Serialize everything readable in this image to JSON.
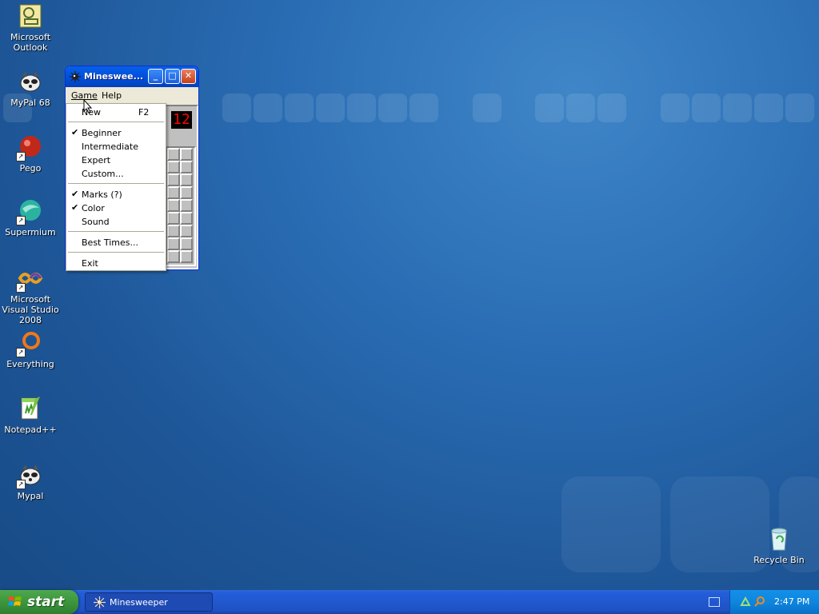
{
  "desktop": {
    "icons": [
      {
        "label": "Microsoft Outlook",
        "icon": "outlook-icon"
      },
      {
        "label": "MyPal 68",
        "icon": "raccoon-icon"
      },
      {
        "label": "Pego",
        "icon": "pego-icon"
      },
      {
        "label": "Supermium",
        "icon": "supermium-icon"
      },
      {
        "label": "Microsoft Visual Studio 2008",
        "icon": "visual-studio-icon"
      },
      {
        "label": "Everything",
        "icon": "everything-icon"
      },
      {
        "label": "Notepad++",
        "icon": "notepadpp-icon"
      },
      {
        "label": "Mypal",
        "icon": "raccoon-icon"
      },
      {
        "label": "Recycle Bin",
        "icon": "recycle-bin-icon"
      }
    ]
  },
  "window": {
    "title": "Minesweeper",
    "title_display": "Minesweе...",
    "menus": {
      "game": "Game",
      "help": "Help"
    },
    "mine_counter": "12"
  },
  "game_menu": {
    "new": {
      "label": "New",
      "shortcut": "F2"
    },
    "beginner": {
      "label": "Beginner",
      "checked": true
    },
    "intermediate": {
      "label": "Intermediate",
      "checked": false
    },
    "expert": {
      "label": "Expert",
      "checked": false
    },
    "custom": {
      "label": "Custom...",
      "checked": false
    },
    "marks": {
      "label": "Marks (?)",
      "checked": true
    },
    "color": {
      "label": "Color",
      "checked": true
    },
    "sound": {
      "label": "Sound",
      "checked": false
    },
    "best_times": {
      "label": "Best Times..."
    },
    "exit": {
      "label": "Exit"
    },
    "check_glyph": "✔"
  },
  "taskbar": {
    "start_label": "start",
    "task_label": "Minesweeper",
    "clock": "2:47 PM"
  },
  "colors": {
    "desktop_blue": "#2a6db4",
    "titlebar_blue": "#0053e0",
    "start_green": "#3c963c",
    "close_red": "#c8401a"
  }
}
